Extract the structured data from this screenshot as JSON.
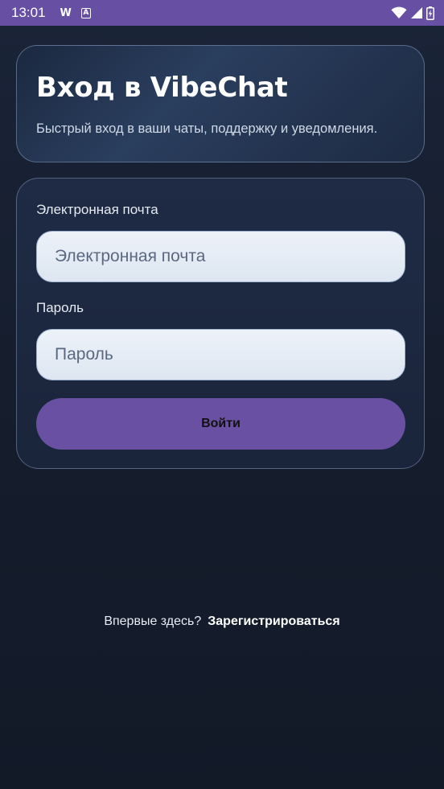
{
  "status_bar": {
    "time": "13:01",
    "notification_w": "W",
    "notification_a": "A",
    "icons": [
      "wifi-icon",
      "cellular-signal-icon",
      "battery-charging-icon"
    ]
  },
  "header": {
    "title": "Вход в VibeChat",
    "subtitle": "Быстрый вход в ваши чаты, поддержку и уведомления."
  },
  "form": {
    "email_label": "Электронная почта",
    "email_placeholder": "Электронная почта",
    "password_label": "Пароль",
    "password_placeholder": "Пароль",
    "login_button": "Войти"
  },
  "footer": {
    "prompt": "Впервые здесь?",
    "register_link": "Зарегистрироваться"
  },
  "colors": {
    "accent": "#6a50a3",
    "status_bar": "#6750a4",
    "background": "#161e2e",
    "input_background": "#e6edf5"
  }
}
